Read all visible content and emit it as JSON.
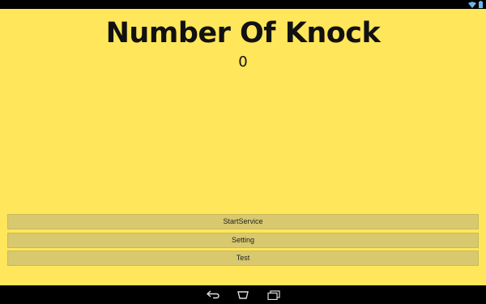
{
  "app": {
    "title": "Number Of Knock",
    "count": "0"
  },
  "buttons": {
    "start_service": "StartService",
    "setting": "Setting",
    "test": "Test"
  },
  "colors": {
    "background": "#ffe65a",
    "button": "#d8c86e",
    "system_bars": "#000000"
  },
  "status_bar": {
    "icons": [
      "wifi-icon",
      "battery-icon"
    ]
  },
  "nav_bar": {
    "icons": [
      "back-icon",
      "home-icon",
      "recents-icon"
    ]
  }
}
